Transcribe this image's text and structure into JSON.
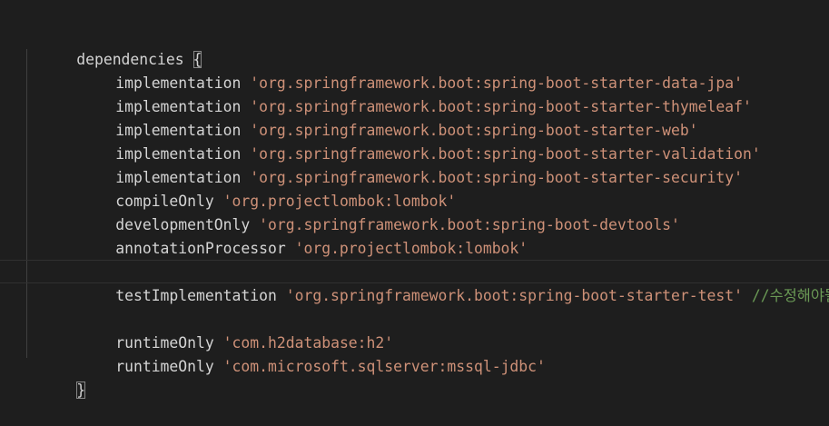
{
  "editor": {
    "lines": [
      {
        "keyword": "dependencies",
        "sep": " ",
        "brace": "{"
      },
      {
        "keyword": "implementation",
        "sep": " ",
        "string": "'org.springframework.boot:spring-boot-starter-data-jpa'"
      },
      {
        "keyword": "implementation",
        "sep": " ",
        "string": "'org.springframework.boot:spring-boot-starter-thymeleaf'"
      },
      {
        "keyword": "implementation",
        "sep": " ",
        "string": "'org.springframework.boot:spring-boot-starter-web'"
      },
      {
        "keyword": "implementation",
        "sep": " ",
        "string": "'org.springframework.boot:spring-boot-starter-validation'"
      },
      {
        "keyword": "implementation",
        "sep": " ",
        "string": "'org.springframework.boot:spring-boot-starter-security'"
      },
      {
        "keyword": "compileOnly",
        "sep": " ",
        "string": "'org.projectlombok:lombok'"
      },
      {
        "keyword": "developmentOnly",
        "sep": " ",
        "string": "'org.springframework.boot:spring-boot-devtools'"
      },
      {
        "keyword": "annotationProcessor",
        "sep": " ",
        "string": "'org.projectlombok:lombok'"
      },
      {
        "keyword": "testImplementation",
        "sep": " ",
        "string": "'org.springframework.boot:spring-boot-starter-test'",
        "comment": "//수정해야될수"
      },
      {
        "keyword": "runtimeOnly",
        "sep": " ",
        "string": "'com.h2database:h2'"
      },
      {
        "keyword": "runtimeOnly",
        "sep": " ",
        "string": "'com.microsoft.sqlserver:mssql-jdbc'"
      },
      {
        "brace": "}"
      }
    ]
  },
  "colors": {
    "background": "#1e1e1e",
    "text": "#d4d4d4",
    "string": "#ce9178",
    "comment": "#6a9955"
  }
}
